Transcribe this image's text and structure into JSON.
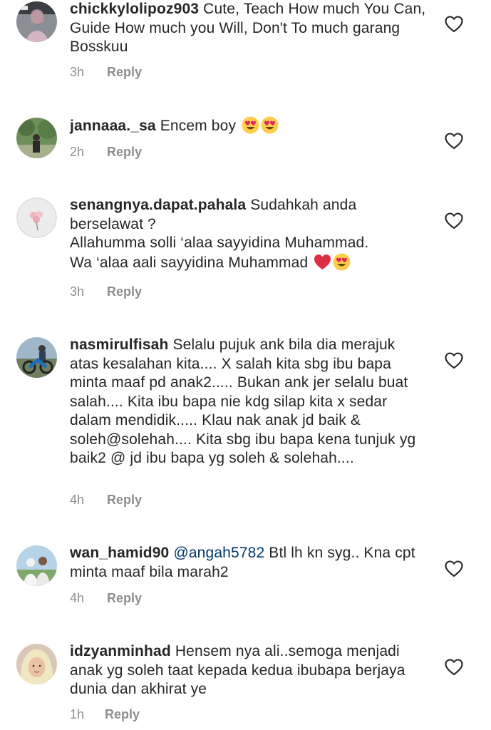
{
  "comments": [
    {
      "username": "chickkylolipoz903",
      "text": " Cute, Teach How much You Can, Guide How much you Will, Don't To much garang Bosskuu",
      "mention": "",
      "time": "3h",
      "reply_label": "Reply",
      "avatar_icon": "avatar-photo-person-indoor"
    },
    {
      "username": "jannaaa._sa",
      "text": " Encem boy",
      "mention": "",
      "emojis": [
        "heart-eyes-emoji",
        "heart-eyes-emoji"
      ],
      "time": "2h",
      "reply_label": "Reply",
      "avatar_icon": "avatar-photo-person-tree"
    },
    {
      "username": "senangnya.dapat.pahala",
      "text": " Sudahkah anda berselawat ?\nAllahumma solli ‘alaa sayyidina Muhammad.\nWa ‘alaa aali sayyidina Muhammad",
      "mention": "",
      "emojis": [
        "red-heart-emoji",
        "heart-eyes-emoji"
      ],
      "time": "3h",
      "reply_label": "Reply",
      "avatar_icon": "avatar-photo-flowers"
    },
    {
      "username": "nasmirulfisah",
      "text": " Selalu pujuk ank bila dia merajuk atas kesalahan kita.... X salah kita sbg ibu bapa minta maaf pd anak2..... Bukan ank jer selalu buat salah.... Kita ibu bapa nie kdg silap kita x sedar dalam mendidik..... Klau nak anak jd baik & soleh@solehah.... Kita sbg ibu bapa kena tunjuk yg baik2 @ jd ibu bapa yg soleh & solehah....",
      "mention": "",
      "time": "4h",
      "reply_label": "Reply",
      "avatar_icon": "avatar-photo-motorcycle"
    },
    {
      "username": "wan_hamid90",
      "mention": "@angah5782",
      "text": " Btl lh kn syg.. Kna cpt minta maaf bila marah2",
      "time": "4h",
      "reply_label": "Reply",
      "avatar_icon": "avatar-photo-couple"
    },
    {
      "username": "idzyanminhad",
      "text": " Hensem nya ali..semoga menjadi anak yg soleh taat kepada kedua ibubapa berjaya dunia dan akhirat ye",
      "mention": "",
      "time": "1h",
      "reply_label": "Reply",
      "avatar_icon": "avatar-photo-woman-hijab"
    }
  ],
  "like_icon": "heart-outline-icon",
  "colors": {
    "text": "#262626",
    "meta": "#8e8e8e",
    "mention": "#00376b"
  }
}
